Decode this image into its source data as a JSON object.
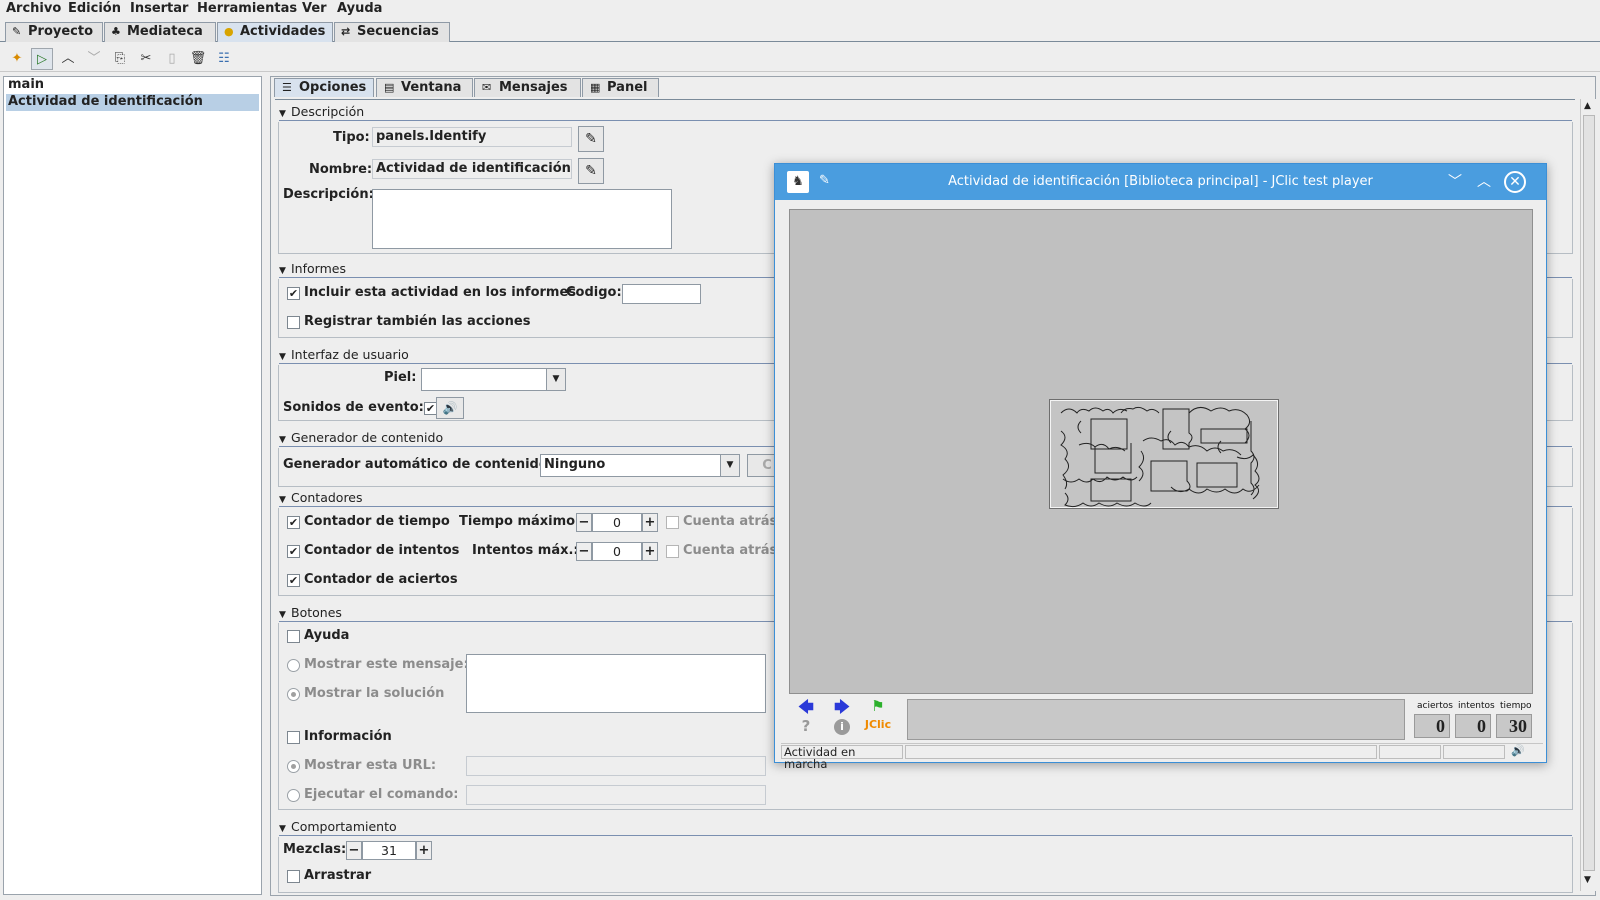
{
  "menubar": {
    "items": [
      "Archivo",
      "Edición",
      "Insertar",
      "Herramientas",
      "Ver",
      "Ayuda"
    ]
  },
  "main_tabs": [
    {
      "label": "Proyecto",
      "icon": "pencil-icon"
    },
    {
      "label": "Mediateca",
      "icon": "media-icon"
    },
    {
      "label": "Actividades",
      "icon": "activities-icon",
      "active": true
    },
    {
      "label": "Secuencias",
      "icon": "sequence-icon"
    }
  ],
  "toolbar": {
    "buttons": [
      "new-activity",
      "test-activity",
      "move-up",
      "move-down",
      "copy",
      "cut",
      "paste",
      "delete",
      "show-list"
    ]
  },
  "activity_list": {
    "items": [
      "main",
      "Actividad de identificación"
    ],
    "selected": 1
  },
  "sub_tabs": [
    {
      "label": "Opciones",
      "active": true
    },
    {
      "label": "Ventana"
    },
    {
      "label": "Mensajes"
    },
    {
      "label": "Panel"
    }
  ],
  "sections": {
    "descripcion": {
      "title": "Descripción",
      "tipo_label": "Tipo:",
      "tipo_value": "panels.Identify",
      "nombre_label": "Nombre:",
      "nombre_value": "Actividad de identificación",
      "descripcion_label": "Descripción:",
      "descripcion_value": ""
    },
    "informes": {
      "title": "Informes",
      "incluir_label": "Incluir esta actividad en los informes",
      "incluir_checked": true,
      "codigo_label": "Codigo:",
      "codigo_value": "",
      "registrar_label": "Registrar también las acciones",
      "registrar_checked": false
    },
    "interfaz": {
      "title": "Interfaz de usuario",
      "piel_label": "Piel:",
      "piel_value": "",
      "sonidos_label": "Sonidos de evento:",
      "sonidos_checked": true
    },
    "generador": {
      "title": "Generador de contenido",
      "auto_label": "Generador automático de contenido:",
      "auto_value": "Ninguno",
      "config_button": "C"
    },
    "contadores": {
      "title": "Contadores",
      "tiempo_label": "Contador de tiempo",
      "tiempo_checked": true,
      "tiempo_max_label": "Tiempo máximo:",
      "tiempo_max_value": "0",
      "cuenta_atras_label": "Cuenta atrás",
      "intentos_label": "Contador de intentos",
      "intentos_checked": true,
      "intentos_max_label": "Intentos máx.:",
      "intentos_max_value": "0",
      "cuenta_atras2_label": "Cuenta atrás",
      "aciertos_label": "Contador de aciertos",
      "aciertos_checked": true
    },
    "botones": {
      "title": "Botones",
      "ayuda_label": "Ayuda",
      "ayuda_checked": false,
      "mostrar_mensaje_label": "Mostrar este mensaje:",
      "mostrar_solucion_label": "Mostrar la solución",
      "informacion_label": "Información",
      "informacion_checked": false,
      "mostrar_url_label": "Mostrar esta URL:",
      "ejecutar_label": "Ejecutar el comando:"
    },
    "comportamiento": {
      "title": "Comportamiento",
      "mezclas_label": "Mezclas:",
      "mezclas_value": "31",
      "arrastrar_label": "Arrastrar",
      "arrastrar_checked": false
    }
  },
  "player": {
    "title": "Actividad de identificación [Biblioteca principal] - JClic test player",
    "status": "Actividad en marcha",
    "counters": [
      {
        "label": "aciertos",
        "value": "0"
      },
      {
        "label": "intentos",
        "value": "0"
      },
      {
        "label": "tiempo",
        "value": "30"
      }
    ],
    "jclic_label": "JClic",
    "help_glyph": "?",
    "info_glyph": "i"
  },
  "colors": {
    "titlebar": "#4a9ddf",
    "selection": "#b8cfe5",
    "stage": "#c0c0c0"
  }
}
